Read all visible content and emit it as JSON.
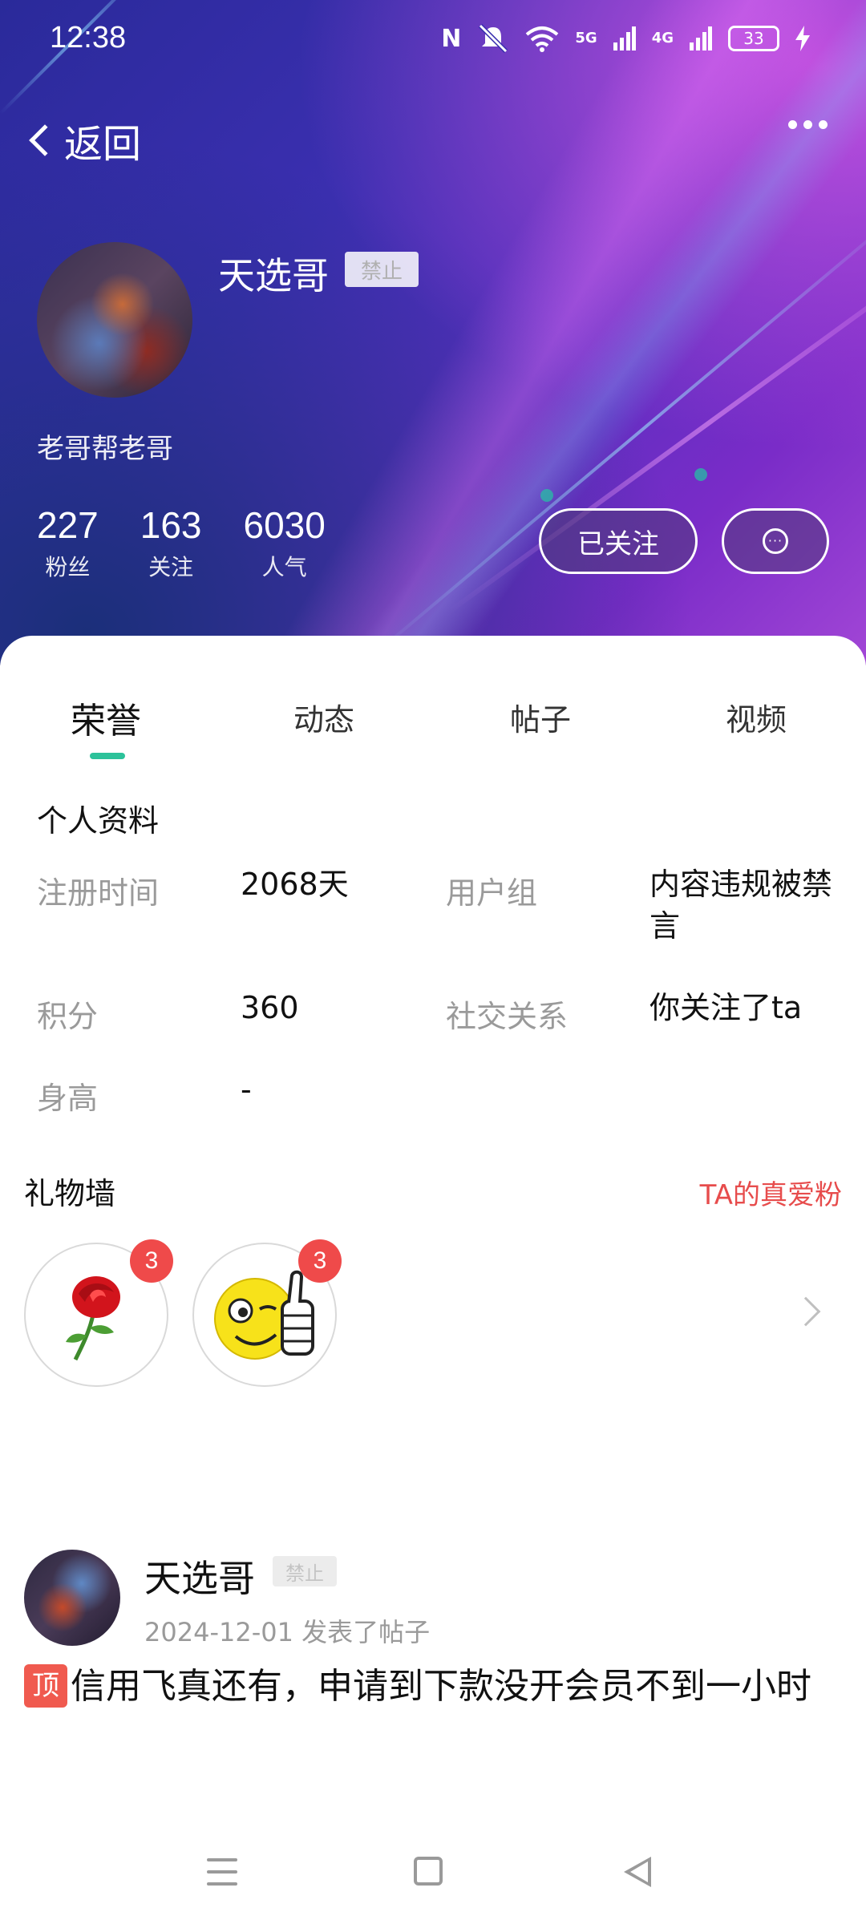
{
  "status_bar": {
    "time": "12:38",
    "network_5g": "5G",
    "network_4g": "4G",
    "battery": "33"
  },
  "header": {
    "back_label": "返回"
  },
  "profile": {
    "name": "天选哥",
    "ban_badge": "禁止",
    "bio": "老哥帮老哥",
    "stats": [
      {
        "value": "227",
        "label": "粉丝"
      },
      {
        "value": "163",
        "label": "关注"
      },
      {
        "value": "6030",
        "label": "人气"
      }
    ],
    "follow_button": "已关注",
    "message_dots": "···"
  },
  "tabs": [
    "荣誉",
    "动态",
    "帖子",
    "视频"
  ],
  "active_tab": "荣誉",
  "personal_info": {
    "title": "个人资料",
    "items": [
      {
        "label": "注册时间",
        "value": "2068天"
      },
      {
        "label": "用户组",
        "value": "内容违规被禁言"
      },
      {
        "label": "积分",
        "value": "360"
      },
      {
        "label": "社交关系",
        "value": "你关注了ta"
      },
      {
        "label": "身高",
        "value": "-"
      }
    ]
  },
  "gift_wall": {
    "title": "礼物墙",
    "link": "TA的真爱粉",
    "gifts": [
      {
        "name": "rose",
        "count": "3"
      },
      {
        "name": "thumbs-up-emoji",
        "count": "3"
      }
    ]
  },
  "post": {
    "author": "天选哥",
    "ban_badge": "禁止",
    "meta": "2024-12-01  发表了帖子",
    "pin_tag": "顶",
    "content": "信用飞真还有，申请到下款没开会员不到一小时"
  },
  "colors": {
    "accent": "#2cc29a",
    "link_red": "#e74c4c",
    "badge_red": "#ef4a4a"
  }
}
